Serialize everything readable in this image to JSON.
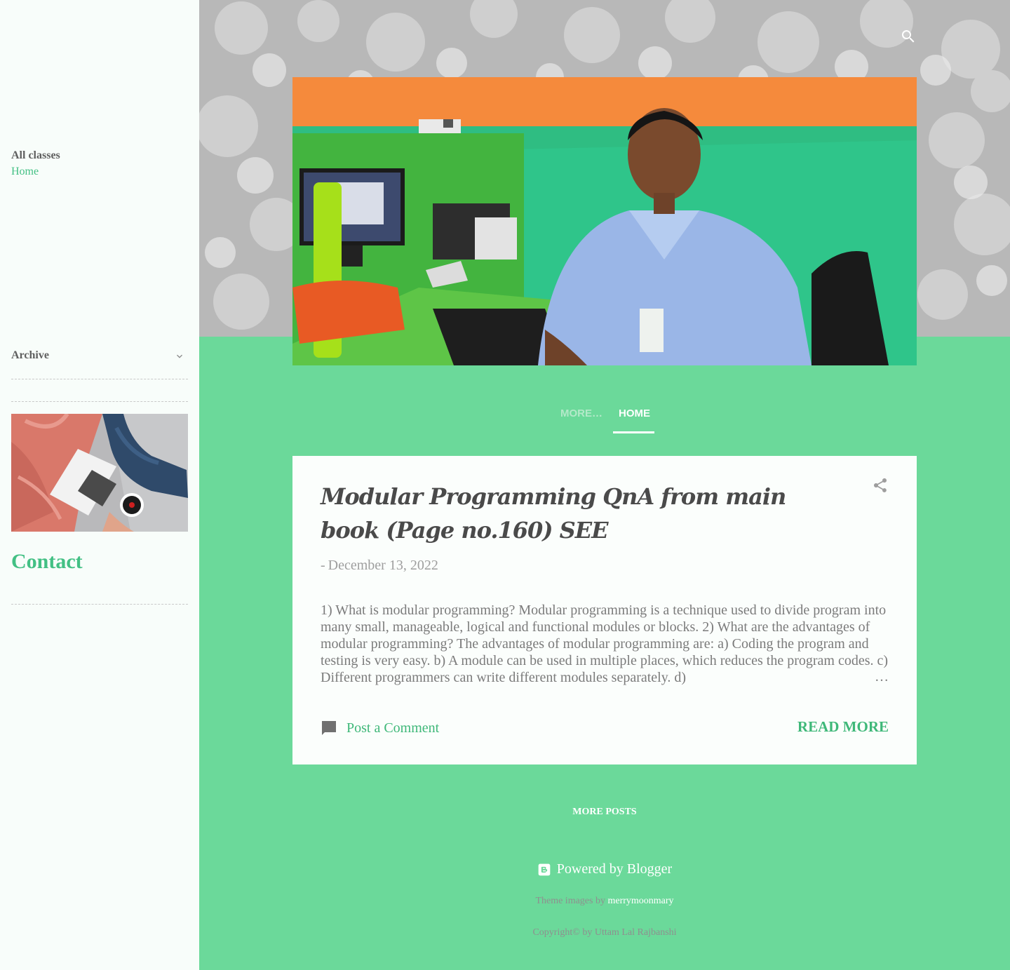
{
  "sidebar": {
    "pages_title": "All classes",
    "pages": [
      {
        "label": "Home"
      }
    ],
    "archive_title": "Archive",
    "contact_title": "Contact"
  },
  "header": {
    "search_icon": "search-icon"
  },
  "nav": {
    "more_label": "MORE…",
    "home_label": "HOME"
  },
  "post": {
    "title": "Modular Programming QnA from main book (Page no.160) SEE",
    "date_prefix": "-",
    "date": "December 13, 2022",
    "snippet": "  1)     What is modular programming? Modular programming is a technique used to divide program into many small, manageable, logical and functional modules or blocks.   2)     What are the advantages of modular programming? The advantages of modular programming are: a)      Coding the program and testing is very easy. b)     A module can be used in multiple places, which reduces the program codes. c)      Different programmers can write different modules separately. d)",
    "ellipsis": "…",
    "comment_label": "Post a Comment",
    "read_more_label": "Read more",
    "share_icon": "share-icon",
    "comment_icon": "comment-icon"
  },
  "footer": {
    "more_posts_label": "MORE POSTS",
    "powered_label": "Powered by Blogger",
    "theme_prefix": "Theme images by ",
    "theme_author": "merrymoonmary",
    "copyright": "Copyright© by Uttam Lal Rajbanshi"
  },
  "colors": {
    "accent_green": "#6bd99a",
    "link_green": "#3fb879",
    "sidebar_bg": "#f8fdfa",
    "card_bg": "#fbfefc"
  }
}
